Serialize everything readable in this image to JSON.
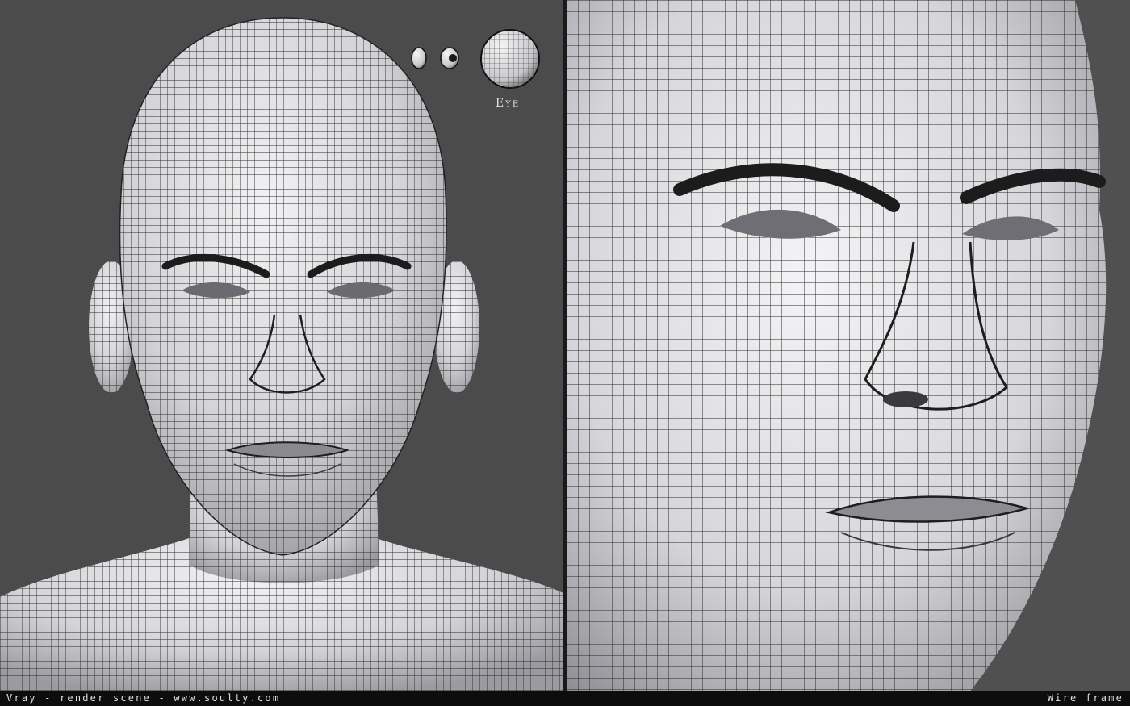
{
  "eye_label": "Eye",
  "footer": {
    "left_text": "Vray - render scene - www.soulty.com",
    "right_text": "Wire frame"
  },
  "colors": {
    "background": "#4b4b4b",
    "skin": "#dcdce0",
    "wire": "#2a2a2a",
    "footer_bg": "#0d0d0d",
    "footer_text": "#e2e2e2"
  }
}
